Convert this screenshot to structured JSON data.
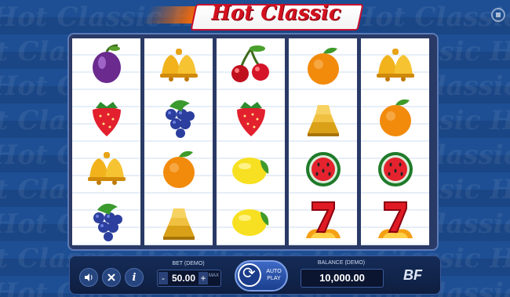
{
  "game": {
    "title": "Hot Classic"
  },
  "background_text": "Hot Classic",
  "reels": [
    [
      "plum",
      "strawberry",
      "bell",
      "grapes"
    ],
    [
      "bell",
      "grapes",
      "orange",
      "gold-bar"
    ],
    [
      "cherries",
      "strawberry",
      "lemon",
      "lemon"
    ],
    [
      "orange",
      "gold-bar",
      "watermelon",
      "seven"
    ],
    [
      "bell",
      "orange",
      "watermelon",
      "seven"
    ]
  ],
  "controls": {
    "bet_label": "BET (DEMO)",
    "bet_value": "50.00",
    "bet_minus": "-",
    "bet_plus": "+",
    "bet_max": "MAX",
    "autoplay_label": "AUTO PLAY",
    "balance_label": "BALANCE (DEMO)",
    "balance_value": "10,000.00",
    "info_label": "i",
    "brand": "BF"
  },
  "colors": {
    "background": "#1d4a8c",
    "logo_red": "#d4111f",
    "reel_bg": "#ffffff"
  }
}
